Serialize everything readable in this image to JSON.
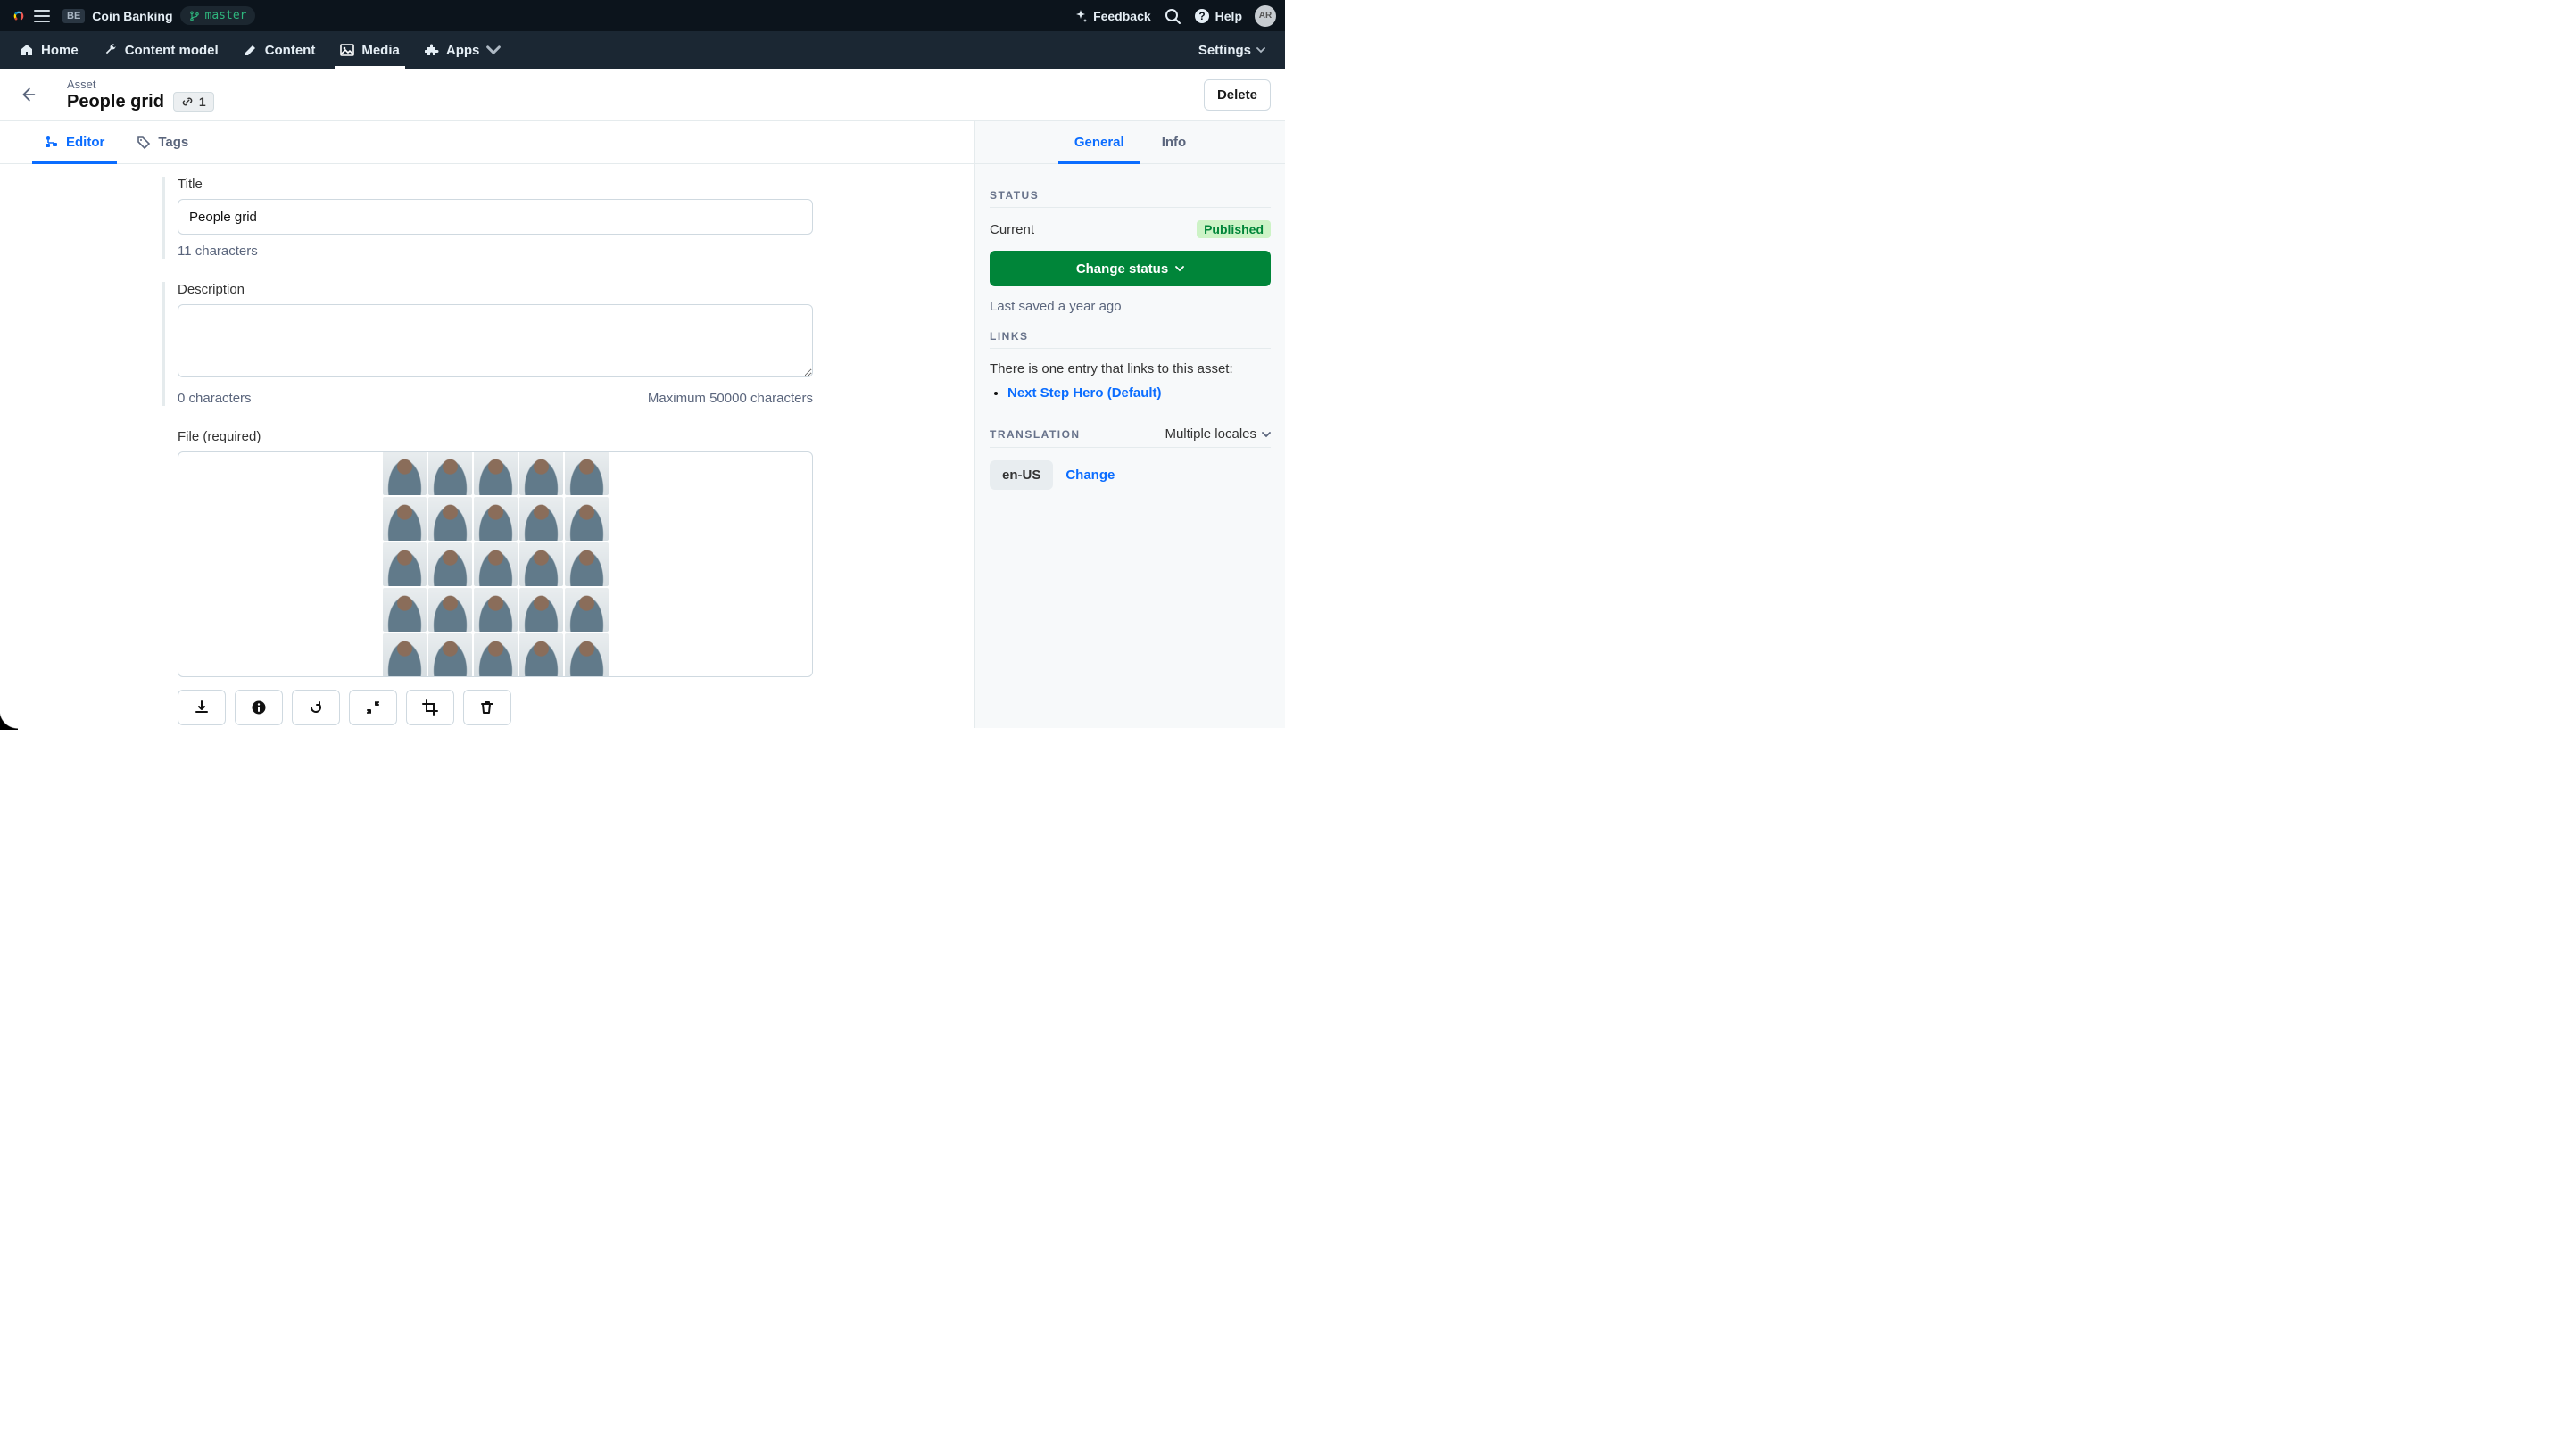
{
  "projectBar": {
    "workspaceBadge": "BE",
    "projectName": "Coin Banking",
    "branch": "master",
    "feedback": "Feedback",
    "help": "Help",
    "avatarInitials": "AR"
  },
  "nav": {
    "home": "Home",
    "contentModel": "Content model",
    "content": "Content",
    "media": "Media",
    "apps": "Apps",
    "settings": "Settings"
  },
  "pageHeader": {
    "crumb": "Asset",
    "title": "People grid",
    "linkCount": "1",
    "deleteLabel": "Delete"
  },
  "tabs": {
    "editor": "Editor",
    "tags": "Tags"
  },
  "form": {
    "titleLabel": "Title",
    "titleValue": "People grid",
    "titleCount": "11 characters",
    "descLabel": "Description",
    "descValue": "",
    "descCount": "0 characters",
    "descMax": "Maximum 50000 characters",
    "fileLabel": "File (required)"
  },
  "sidebar": {
    "tabGeneral": "General",
    "tabInfo": "Info",
    "statusHeading": "STATUS",
    "statusCurrentLabel": "Current",
    "statusValue": "Published",
    "changeStatus": "Change status",
    "lastSaved": "Last saved a year ago",
    "linksHeading": "LINKS",
    "linksText": "There is one entry that links to this asset:",
    "linkedEntry": "Next Step Hero (Default)",
    "translationHeading": "TRANSLATION",
    "multipleLocales": "Multiple locales",
    "localeChip": "en-US",
    "localeChange": "Change"
  }
}
